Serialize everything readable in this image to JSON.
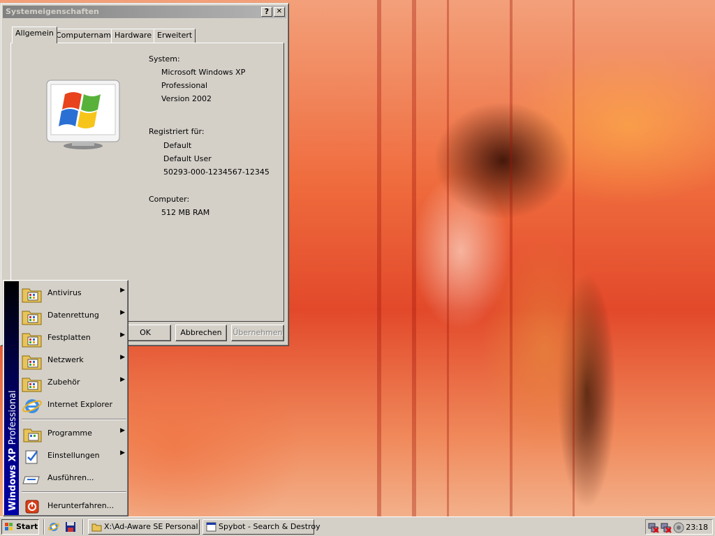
{
  "window": {
    "title": "Systemeigenschaften",
    "help_glyph": "?",
    "close_glyph": "✕",
    "tabs": [
      "Allgemein",
      "Computername",
      "Hardware",
      "Erweitert"
    ],
    "system_label": "System:",
    "system_lines": [
      "Microsoft Windows XP",
      "Professional",
      "Version 2002"
    ],
    "registered_label": "Registriert für:",
    "registered_lines": [
      "Default",
      "Default User",
      "50293-000-1234567-12345"
    ],
    "computer_label": "Computer:",
    "computer_lines": [
      "512 MB RAM"
    ],
    "buttons": {
      "ok": "OK",
      "cancel": "Abbrechen",
      "apply": "Übernehmen"
    }
  },
  "start_menu": {
    "sidebar_bold": "Windows XP",
    "sidebar_normal": "Professional",
    "items": [
      {
        "label": "Antivirus",
        "icon": "program-folder-icon",
        "submenu": true
      },
      {
        "label": "Datenrettung",
        "icon": "program-folder-icon",
        "submenu": true
      },
      {
        "label": "Festplatten",
        "icon": "program-folder-icon",
        "submenu": true
      },
      {
        "label": "Netzwerk",
        "icon": "program-folder-icon",
        "submenu": true
      },
      {
        "label": "Zubehör",
        "icon": "program-folder-icon",
        "submenu": true
      },
      {
        "label": "Internet Explorer",
        "icon": "internet-explorer-icon",
        "submenu": false
      },
      {
        "label": "Programme",
        "icon": "programs-icon",
        "submenu": true
      },
      {
        "label": "Einstellungen",
        "icon": "settings-icon",
        "submenu": true
      },
      {
        "label": "Ausführen...",
        "icon": "run-icon",
        "submenu": false
      },
      {
        "label": "Herunterfahren...",
        "icon": "shutdown-icon",
        "submenu": false
      }
    ],
    "arrow_glyph": "▶"
  },
  "taskbar": {
    "start_label": "Start",
    "tasks": [
      "X:\\Ad-Aware SE Personal",
      "Spybot - Search & Destroy"
    ],
    "clock": "23:18"
  }
}
